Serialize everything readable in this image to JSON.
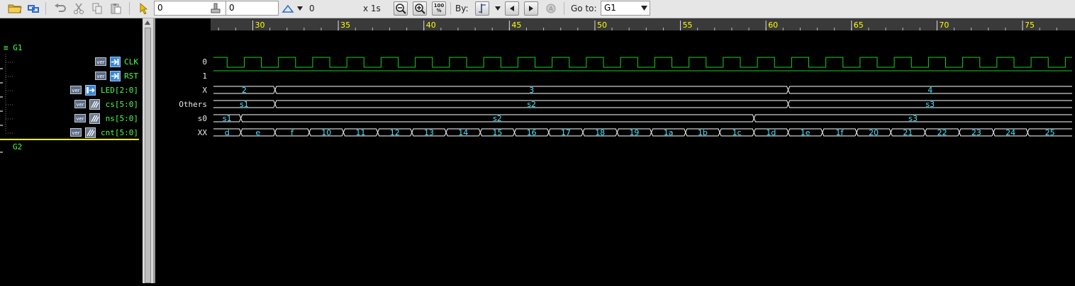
{
  "toolbar": {
    "cursor_time_value": "0",
    "marker_time_value": "0",
    "delta_value": "0",
    "scale_label": "x 1s",
    "zoom_100_label": "100\n%",
    "by_label": "By:",
    "goto_label": "Go to:",
    "goto_value": "G1"
  },
  "groups": [
    {
      "name": "G1"
    },
    {
      "name": "G2"
    }
  ],
  "signals": [
    {
      "badge": "ver",
      "name": "CLK",
      "value": "0",
      "icon": "input-port-icon"
    },
    {
      "badge": "ver",
      "name": "RST",
      "value": "1",
      "icon": "input-port-icon"
    },
    {
      "badge": "ver",
      "name": "LED[2:0]",
      "value": "X",
      "icon": "output-port-icon"
    },
    {
      "badge": "ver",
      "name": "cs[5:0]",
      "value": "Others",
      "icon": "register-icon"
    },
    {
      "badge": "ver",
      "name": "ns[5:0]",
      "value": "s0",
      "icon": "register-icon"
    },
    {
      "badge": "ver",
      "name": "cnt[5:0]",
      "value": "XX",
      "icon": "register-icon"
    }
  ],
  "timeline": {
    "start": 27.7,
    "end": 77.9,
    "major_labels": [
      "30",
      "35",
      "40",
      "45",
      "50",
      "55",
      "60",
      "65",
      "70",
      "75"
    ],
    "major_values": [
      30,
      35,
      40,
      45,
      50,
      55,
      60,
      65,
      70,
      75
    ]
  },
  "waves": {
    "clk": {
      "start_level": 1,
      "half_period": 1,
      "first_edge": 28.5
    },
    "rst": {
      "level": 1
    },
    "led": [
      {
        "label": "2",
        "from": 27.7,
        "to": 31.3
      },
      {
        "label": "3",
        "from": 31.3,
        "to": 61.3
      },
      {
        "label": "4",
        "from": 61.3,
        "to": 77.9
      }
    ],
    "cs": [
      {
        "label": "s1",
        "from": 27.7,
        "to": 31.3
      },
      {
        "label": "s2",
        "from": 31.3,
        "to": 61.3
      },
      {
        "label": "s3",
        "from": 61.3,
        "to": 77.9
      }
    ],
    "ns": [
      {
        "label": "s1",
        "from": 27.7,
        "to": 29.3
      },
      {
        "label": "s2",
        "from": 29.3,
        "to": 59.3
      },
      {
        "label": "s3",
        "from": 59.3,
        "to": 77.9
      }
    ],
    "cnt": [
      {
        "label": "d",
        "from": 27.7,
        "to": 29.3
      },
      {
        "label": "e",
        "from": 29.3,
        "to": 31.3
      },
      {
        "label": "f",
        "from": 31.3,
        "to": 33.3
      },
      {
        "label": "10",
        "from": 33.3,
        "to": 35.3
      },
      {
        "label": "11",
        "from": 35.3,
        "to": 37.3
      },
      {
        "label": "12",
        "from": 37.3,
        "to": 39.3
      },
      {
        "label": "13",
        "from": 39.3,
        "to": 41.3
      },
      {
        "label": "14",
        "from": 41.3,
        "to": 43.3
      },
      {
        "label": "15",
        "from": 43.3,
        "to": 45.3
      },
      {
        "label": "16",
        "from": 45.3,
        "to": 47.3
      },
      {
        "label": "17",
        "from": 47.3,
        "to": 49.3
      },
      {
        "label": "18",
        "from": 49.3,
        "to": 51.3
      },
      {
        "label": "19",
        "from": 51.3,
        "to": 53.3
      },
      {
        "label": "1a",
        "from": 53.3,
        "to": 55.3
      },
      {
        "label": "1b",
        "from": 55.3,
        "to": 57.3
      },
      {
        "label": "1c",
        "from": 57.3,
        "to": 59.3
      },
      {
        "label": "1d",
        "from": 59.3,
        "to": 61.3
      },
      {
        "label": "1e",
        "from": 61.3,
        "to": 63.3
      },
      {
        "label": "1f",
        "from": 63.3,
        "to": 65.3
      },
      {
        "label": "20",
        "from": 65.3,
        "to": 67.3
      },
      {
        "label": "21",
        "from": 67.3,
        "to": 69.3
      },
      {
        "label": "22",
        "from": 69.3,
        "to": 71.3
      },
      {
        "label": "23",
        "from": 71.3,
        "to": 73.3
      },
      {
        "label": "24",
        "from": 73.3,
        "to": 75.3
      },
      {
        "label": "25",
        "from": 75.3,
        "to": 77.9
      }
    ]
  },
  "colors": {
    "clk_wave": "#19d219",
    "clk_low": "#a8e8ff",
    "bus_text": "#46e6ff",
    "bus_line": "#ffffff",
    "ruler_label": "#ffff00",
    "ruler_bg": "#3a3a3a",
    "group_text": "#4cff4c",
    "group_separator": "#ffff00"
  }
}
